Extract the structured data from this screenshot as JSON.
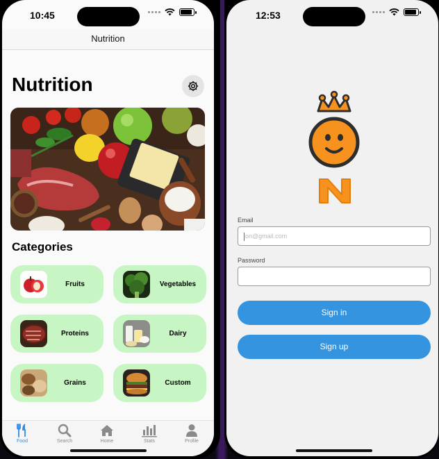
{
  "left_screen": {
    "status_time": "10:45",
    "nav_title": "Nutrition",
    "page_title": "Nutrition",
    "settings_icon": "gear-icon",
    "hero_image": "food-ingredients-photo",
    "section_title": "Categories",
    "categories": [
      {
        "label": "Fruits",
        "thumb": "apple-photo"
      },
      {
        "label": "Vegetables",
        "thumb": "broccoli-photo"
      },
      {
        "label": "Proteins",
        "thumb": "steak-photo"
      },
      {
        "label": "Dairy",
        "thumb": "dairy-photo"
      },
      {
        "label": "Grains",
        "thumb": "grains-photo"
      },
      {
        "label": "Custom",
        "thumb": "burger-photo"
      }
    ],
    "tabs": [
      {
        "label": "Food",
        "icon": "fork-knife-icon",
        "active": true
      },
      {
        "label": "Search",
        "icon": "search-icon",
        "active": false
      },
      {
        "label": "Home",
        "icon": "home-icon",
        "active": false
      },
      {
        "label": "Stats",
        "icon": "bar-chart-icon",
        "active": false
      },
      {
        "label": "Profile",
        "icon": "person-icon",
        "active": false
      }
    ],
    "colors": {
      "card_bg": "#c8f5c4",
      "accent": "#2f8de4"
    }
  },
  "right_screen": {
    "status_time": "12:53",
    "logo_letter": "N",
    "email_label": "Email",
    "email_placeholder": "on@gmail.com",
    "password_label": "Password",
    "password_value": "",
    "signin_label": "Sign in",
    "signup_label": "Sign up",
    "colors": {
      "button": "#3594df",
      "logo_orange": "#f7921e"
    }
  }
}
